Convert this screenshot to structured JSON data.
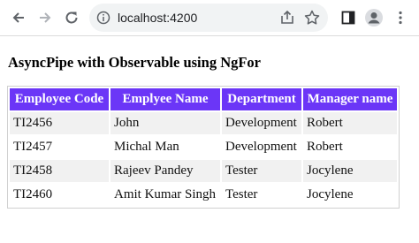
{
  "browser": {
    "url": "localhost:4200",
    "icons": [
      "back-icon",
      "forward-icon",
      "reload-icon",
      "site-info-icon",
      "share-icon",
      "bookmark-star-icon",
      "side-panel-icon",
      "profile-avatar-icon",
      "more-menu-icon"
    ]
  },
  "page": {
    "title": "AsyncPipe with Observable using NgFor",
    "columns": [
      "Employee Code",
      "Emplyee Name",
      "Department",
      "Manager name"
    ],
    "rows": [
      [
        "TI2456",
        "John",
        "Development",
        "Robert"
      ],
      [
        "TI2457",
        "Michal Man",
        "Development",
        "Robert"
      ],
      [
        "TI2458",
        "Rajeev Pandey",
        "Tester",
        "Jocylene"
      ],
      [
        "TI2460",
        "Amit Kumar Singh",
        "Tester",
        "Jocylene"
      ]
    ],
    "header_color": "#6b36f7"
  }
}
